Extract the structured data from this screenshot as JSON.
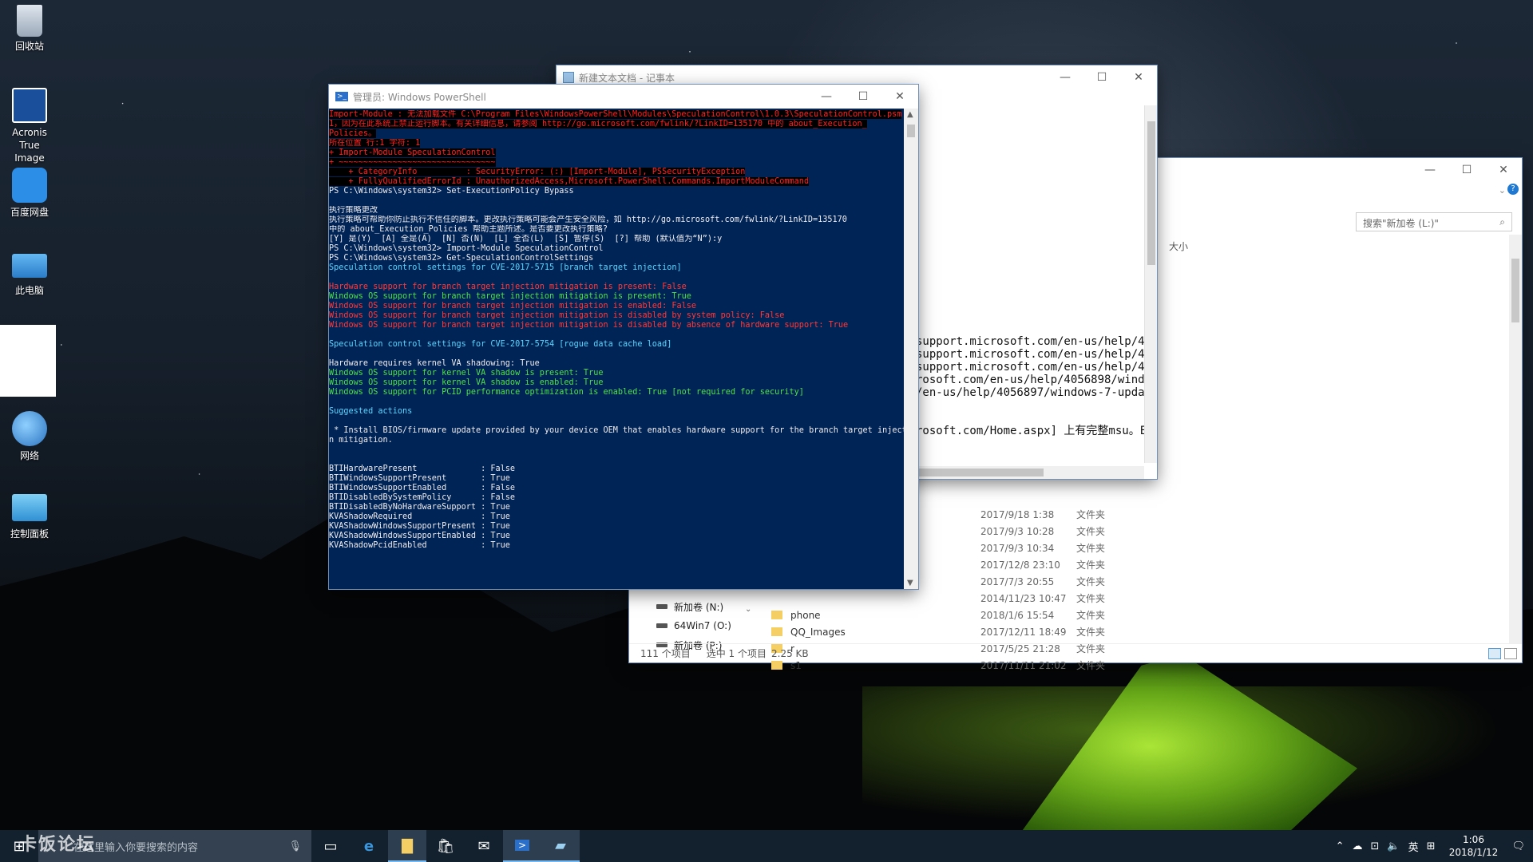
{
  "desktop": {
    "icons": [
      {
        "label": "回收站"
      },
      {
        "label": "Acronis True Image"
      },
      {
        "label": "百度网盘"
      },
      {
        "label": "此电脑"
      },
      {
        "label": "网络"
      },
      {
        "label": "控制面板"
      }
    ],
    "watermark": "卡饭论坛"
  },
  "explorer": {
    "search_placeholder": "搜索\"新加卷 (L:)\"",
    "column_size": "大小",
    "nav": [
      {
        "label": "新加卷 (N:)"
      },
      {
        "label": "64Win7  (O:)"
      },
      {
        "label": "新加卷 (P:)"
      }
    ],
    "rows": [
      {
        "name": "",
        "date": "2017/9/18 1:38",
        "type": "文件夹"
      },
      {
        "name": "",
        "date": "2017/9/3 10:28",
        "type": "文件夹"
      },
      {
        "name": "",
        "date": "2017/9/3 10:34",
        "type": "文件夹"
      },
      {
        "name": "",
        "date": "2017/12/8 23:10",
        "type": "文件夹"
      },
      {
        "name": "",
        "date": "2017/7/3 20:55",
        "type": "文件夹"
      },
      {
        "name": "",
        "date": "2014/11/23 10:47",
        "type": "文件夹"
      },
      {
        "name": "phone",
        "date": "2018/1/6 15:54",
        "type": "文件夹"
      },
      {
        "name": "QQ_Images",
        "date": "2017/12/11 18:49",
        "type": "文件夹"
      },
      {
        "name": "r",
        "date": "2017/5/25 21:28",
        "type": "文件夹"
      },
      {
        "name": "s1",
        "date": "2017/11/11 21:02",
        "type": "文件夹"
      }
    ],
    "status": {
      "count": "111 个项目",
      "selected": "选中 1 个项目",
      "size": "2.25 KB"
    }
  },
  "notepad": {
    "title": "新建文本文档 - 记事本",
    "lines": [
      "support.microsoft.com/en-us/help/405",
      "support.microsoft.com/en-us/help/405",
      "support.microsoft.com/en-us/help/405",
      "rosoft.com/en-us/help/4056898/window",
      "/en-us/help/4056897/windows-7-update",
      "",
      "",
      "rosoft.com/Home.aspx] 上有完整msu。E"
    ]
  },
  "powershell": {
    "title": "管理员: Windows PowerShell",
    "lines": [
      {
        "t": "Import-Module : 无法加载文件 C:\\Program Files\\WindowsPowerShell\\Modules\\SpeculationControl\\1.0.3\\SpeculationControl.psm",
        "c": "errbg"
      },
      {
        "t": "1，因为在此系统上禁止运行脚本。有关详细信息，请参阅 http://go.microsoft.com/fwlink/?LinkID=135170 中的 about_Execution_",
        "c": "errbg"
      },
      {
        "t": "Policies。",
        "c": "errbg"
      },
      {
        "t": "所在位置 行:1 字符: 1",
        "c": "errbg"
      },
      {
        "t": "+ Import-Module SpeculationControl",
        "c": "errbg"
      },
      {
        "t": "+ ~~~~~~~~~~~~~~~~~~~~~~~~~~~~~~~~",
        "c": "errbg"
      },
      {
        "t": "    + CategoryInfo          : SecurityError: (:) [Import-Module], PSSecurityException",
        "c": "errbg"
      },
      {
        "t": "    + FullyQualifiedErrorId : UnauthorizedAccess,Microsoft.PowerShell.Commands.ImportModuleCommand",
        "c": "errbg"
      },
      {
        "t": "PS C:\\Windows\\system32> Set-ExecutionPolicy Bypass",
        "c": ""
      },
      {
        "t": "",
        "c": ""
      },
      {
        "t": "执行策略更改",
        "c": ""
      },
      {
        "t": "执行策略可帮助你防止执行不信任的脚本。更改执行策略可能会产生安全风险，如 http://go.microsoft.com/fwlink/?LinkID=135170",
        "c": ""
      },
      {
        "t": "中的 about_Execution_Policies 帮助主题所述。是否要更改执行策略?",
        "c": ""
      },
      {
        "t": "[Y] 是(Y)  [A] 全是(A)  [N] 否(N)  [L] 全否(L)  [S] 暂停(S)  [?] 帮助 (默认值为“N”):y",
        "c": ""
      },
      {
        "t": "PS C:\\Windows\\system32> Import-Module SpeculationControl",
        "c": ""
      },
      {
        "t": "PS C:\\Windows\\system32> Get-SpeculationControlSettings",
        "c": ""
      },
      {
        "t": "Speculation control settings for CVE-2017-5715 [branch target injection]",
        "c": "cyan"
      },
      {
        "t": "",
        "c": ""
      },
      {
        "t": "Hardware support for branch target injection mitigation is present: False",
        "c": "dred"
      },
      {
        "t": "Windows OS support for branch target injection mitigation is present: True",
        "c": "grn"
      },
      {
        "t": "Windows OS support for branch target injection mitigation is enabled: False",
        "c": "dred"
      },
      {
        "t": "Windows OS support for branch target injection mitigation is disabled by system policy: False",
        "c": "dred"
      },
      {
        "t": "Windows OS support for branch target injection mitigation is disabled by absence of hardware support: True",
        "c": "dred"
      },
      {
        "t": "",
        "c": ""
      },
      {
        "t": "Speculation control settings for CVE-2017-5754 [rogue data cache load]",
        "c": "cyan"
      },
      {
        "t": "",
        "c": ""
      },
      {
        "t": "Hardware requires kernel VA shadowing: True",
        "c": ""
      },
      {
        "t": "Windows OS support for kernel VA shadow is present: True",
        "c": "grn"
      },
      {
        "t": "Windows OS support for kernel VA shadow is enabled: True",
        "c": "grn"
      },
      {
        "t": "Windows OS support for PCID performance optimization is enabled: True [not required for security]",
        "c": "grn"
      },
      {
        "t": "",
        "c": ""
      },
      {
        "t": "Suggested actions",
        "c": "cyan"
      },
      {
        "t": "",
        "c": ""
      },
      {
        "t": " * Install BIOS/firmware update provided by your device OEM that enables hardware support for the branch target injectio",
        "c": ""
      },
      {
        "t": "n mitigation.",
        "c": ""
      },
      {
        "t": "",
        "c": ""
      },
      {
        "t": "",
        "c": ""
      },
      {
        "t": "BTIHardwarePresent             : False",
        "c": ""
      },
      {
        "t": "BTIWindowsSupportPresent       : True",
        "c": ""
      },
      {
        "t": "BTIWindowsSupportEnabled       : False",
        "c": ""
      },
      {
        "t": "BTIDisabledBySystemPolicy      : False",
        "c": ""
      },
      {
        "t": "BTIDisabledByNoHardwareSupport : True",
        "c": ""
      },
      {
        "t": "KVAShadowRequired              : True",
        "c": ""
      },
      {
        "t": "KVAShadowWindowsSupportPresent : True",
        "c": ""
      },
      {
        "t": "KVAShadowWindowsSupportEnabled : True",
        "c": ""
      },
      {
        "t": "KVAShadowPcidEnabled           : True",
        "c": ""
      },
      {
        "t": "",
        "c": ""
      },
      {
        "t": "",
        "c": ""
      },
      {
        "t": "",
        "c": ""
      },
      {
        "t": "",
        "c": ""
      },
      {
        "t": "PS C:\\Windows\\system32>",
        "c": ""
      }
    ]
  },
  "taskbar": {
    "search_placeholder": "在这里输入你要搜索的内容",
    "ime": "英",
    "time": "1:06",
    "date": "2018/1/12"
  }
}
